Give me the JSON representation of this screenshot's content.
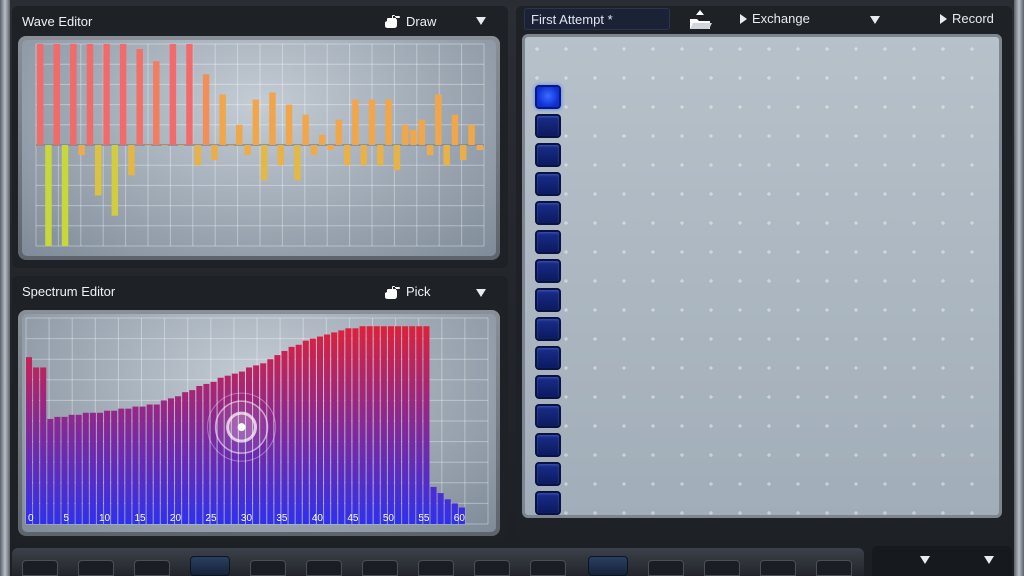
{
  "wave_editor": {
    "title": "Wave Editor",
    "tool_label": "Draw",
    "tool_icon": "hand-icon",
    "menu_icon": "dropdown-arrow-icon"
  },
  "spectrum_editor": {
    "title": "Spectrum Editor",
    "tool_label": "Pick",
    "tool_icon": "hand-icon",
    "menu_icon": "dropdown-arrow-icon",
    "x_tick_labels": [
      "0",
      "5",
      "10",
      "15",
      "20",
      "25",
      "30",
      "35",
      "40",
      "45",
      "50",
      "55",
      "60"
    ]
  },
  "table_panel": {
    "document_name": "First Attempt *",
    "exchange_label": "Exchange",
    "record_label": "Record",
    "slot_count": 15,
    "active_slot": 1
  },
  "colors": {
    "wave_high": "#f26a6a",
    "wave_mid": "#f2a64a",
    "wave_low": "#c8d83a",
    "spectrum_low": "#2f2ff2",
    "spectrum_high": "#e0203a",
    "slot_active": "#2f5cff",
    "slot_idle": "#142770"
  },
  "chart_data": [
    {
      "type": "bar",
      "title": "Wave Editor",
      "ylim": [
        -1,
        1
      ],
      "values": [
        1.0,
        -1.0,
        1.0,
        -1.0,
        1.0,
        -0.1,
        1.0,
        -0.5,
        1.0,
        -0.7,
        1.0,
        -0.3,
        0.95,
        0.0,
        0.83,
        0.0,
        1.0,
        0.0,
        1.0,
        -0.2,
        0.7,
        -0.15,
        0.5,
        0.0,
        0.2,
        -0.1,
        0.45,
        -0.35,
        0.52,
        -0.2,
        0.4,
        -0.35,
        0.3,
        -0.1,
        0.1,
        -0.05,
        0.25,
        -0.2,
        0.45,
        -0.2,
        0.45,
        -0.2,
        0.45,
        -0.25,
        0.2,
        0.15,
        0.25,
        -0.1,
        0.5,
        -0.2,
        0.3,
        -0.15,
        0.2,
        -0.05
      ]
    },
    {
      "type": "bar",
      "title": "Spectrum Editor",
      "x_ticks": [
        0,
        5,
        10,
        15,
        20,
        25,
        30,
        35,
        40,
        45,
        50,
        55,
        60
      ],
      "ylim": [
        0,
        1
      ],
      "values": [
        0.81,
        0.76,
        0.76,
        0.51,
        0.52,
        0.52,
        0.53,
        0.53,
        0.54,
        0.54,
        0.54,
        0.55,
        0.55,
        0.56,
        0.56,
        0.57,
        0.57,
        0.58,
        0.58,
        0.6,
        0.61,
        0.62,
        0.64,
        0.65,
        0.67,
        0.68,
        0.69,
        0.71,
        0.72,
        0.73,
        0.74,
        0.76,
        0.77,
        0.78,
        0.8,
        0.82,
        0.84,
        0.86,
        0.87,
        0.89,
        0.9,
        0.91,
        0.92,
        0.93,
        0.94,
        0.95,
        0.95,
        0.96,
        0.96,
        0.96,
        0.96,
        0.96,
        0.96,
        0.96,
        0.96,
        0.96,
        0.96,
        0.18,
        0.15,
        0.12,
        0.1,
        0.08
      ],
      "selected_bin": 31
    }
  ]
}
